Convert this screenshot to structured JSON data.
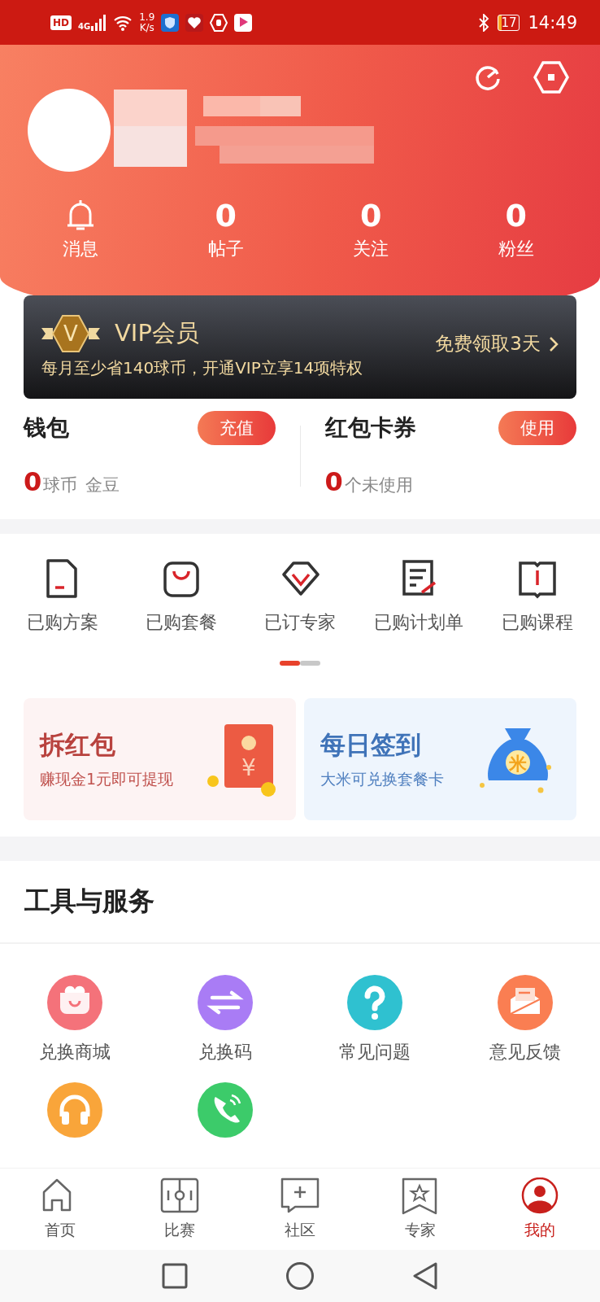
{
  "status_bar": {
    "hd_badge": "HD",
    "network_type": "4G",
    "speed_value": "1.9",
    "speed_unit": "K/s",
    "battery": "17",
    "time": "14:49"
  },
  "header": {
    "stats": [
      {
        "kind": "icon",
        "label": "消息"
      },
      {
        "kind": "count",
        "value": "0",
        "label": "帖子"
      },
      {
        "kind": "count",
        "value": "0",
        "label": "关注"
      },
      {
        "kind": "count",
        "value": "0",
        "label": "粉丝"
      }
    ]
  },
  "vip": {
    "badge": "V",
    "title": "VIP会员",
    "subtitle": "每月至少省140球币，开通VIP立享14项特权",
    "action": "免费领取3天"
  },
  "wallet": [
    {
      "title": "钱包",
      "button": "充值",
      "count": "0",
      "units": [
        "球币",
        "金豆"
      ]
    },
    {
      "title": "红包卡券",
      "button": "使用",
      "count": "0",
      "units": [
        "个未使用"
      ]
    }
  ],
  "shortcuts": {
    "items": [
      {
        "kind": "document",
        "label": "已购方案"
      },
      {
        "kind": "bag",
        "label": "已购套餐"
      },
      {
        "kind": "diamond",
        "label": "已订专家"
      },
      {
        "kind": "checklist",
        "label": "已购计划单"
      },
      {
        "kind": "book",
        "label": "已购课程"
      }
    ],
    "pager": [
      {
        "selected": true
      },
      {
        "selected": false
      }
    ]
  },
  "promos": [
    {
      "kind": "red-envelope",
      "title": "拆红包",
      "subtitle": "赚现金1元即可提现",
      "mark": "¥"
    },
    {
      "kind": "money-bag",
      "title": "每日签到",
      "subtitle": "大米可兑换套餐卡",
      "mark": "米"
    }
  ],
  "tools": {
    "title": "工具与服务",
    "items": [
      {
        "kind": "basket",
        "label": "兑换商城",
        "color": "#f4727a"
      },
      {
        "kind": "exchange",
        "label": "兑换码",
        "color": "#a97cf5"
      },
      {
        "kind": "question",
        "label": "常见问题",
        "color": "#2fc1d0"
      },
      {
        "kind": "mail",
        "label": "意见反馈",
        "color": "#fa7e52"
      },
      {
        "kind": "headphones",
        "color": "#f9a53a"
      },
      {
        "kind": "phone",
        "color": "#3ccb6a"
      }
    ]
  },
  "bottom_nav": [
    {
      "kind": "home",
      "label": "首页",
      "selected": false
    },
    {
      "kind": "match",
      "label": "比赛",
      "selected": false
    },
    {
      "kind": "community",
      "label": "社区",
      "selected": false
    },
    {
      "kind": "expert",
      "label": "专家",
      "selected": false
    },
    {
      "kind": "mine",
      "label": "我的",
      "selected": true
    }
  ]
}
